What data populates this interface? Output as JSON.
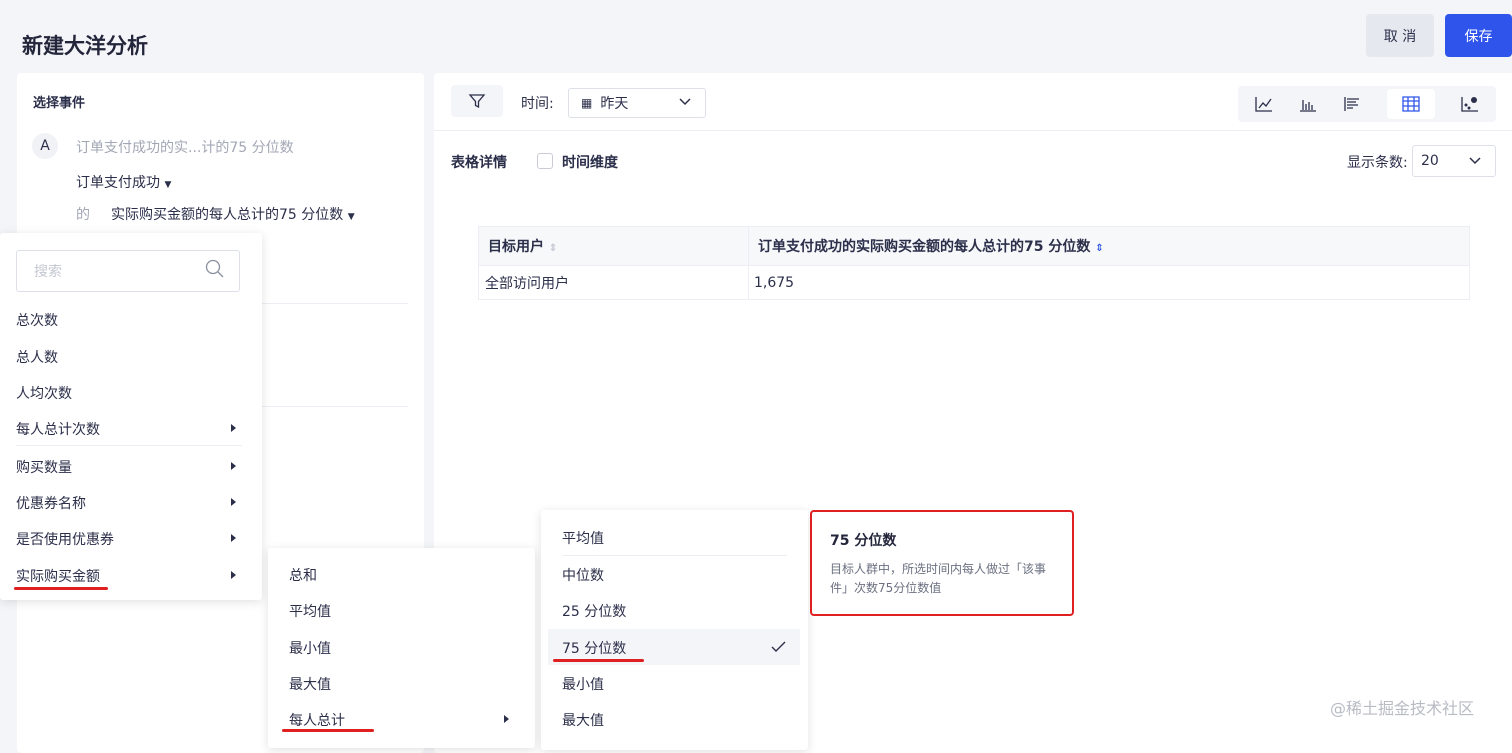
{
  "header": {
    "title": "新建大洋分析",
    "cancel": "取 消",
    "save": "保存"
  },
  "left": {
    "section_title": "选择事件",
    "event_badge": "A",
    "event_name_placeholder": "订单支付成功的实...计的75 分位数",
    "event": "订单支付成功",
    "of": "的",
    "metric": "实际购买金额的每人总计的75 分位数"
  },
  "menu1": {
    "search_placeholder": "搜索",
    "items": [
      {
        "label": "总次数"
      },
      {
        "label": "总人数"
      },
      {
        "label": "人均次数"
      },
      {
        "label": "每人总计次数"
      },
      {
        "label": "购买数量"
      },
      {
        "label": "优惠券名称"
      },
      {
        "label": "是否使用优惠券"
      },
      {
        "label": "实际购买金额"
      }
    ]
  },
  "menu2": {
    "items": [
      {
        "label": "总和"
      },
      {
        "label": "平均值"
      },
      {
        "label": "最小值"
      },
      {
        "label": "最大值"
      },
      {
        "label": "每人总计"
      }
    ]
  },
  "menu3": {
    "items": [
      {
        "label": "平均值"
      },
      {
        "label": "中位数"
      },
      {
        "label": "25 分位数"
      },
      {
        "label": "75 分位数",
        "selected": true
      },
      {
        "label": "最小值"
      },
      {
        "label": "最大值"
      }
    ]
  },
  "tooltip": {
    "title": "75 分位数",
    "desc": "目标人群中，所选时间内每人做过「该事件」次数75分位数值"
  },
  "toolbar": {
    "time_label": "时间:",
    "time_value": "昨天"
  },
  "table_section": {
    "title": "表格详情",
    "time_dim": "时间维度",
    "rows_label": "显示条数:",
    "rows_value": "20",
    "columns": [
      "目标用户",
      "订单支付成功的实际购买金额的每人总计的75 分位数"
    ],
    "rows": [
      [
        "全部访问用户",
        "1,675"
      ]
    ]
  },
  "watermark": "@稀土掘金技术社区",
  "colors": {
    "primary": "#2f54eb",
    "highlight": "#e02020"
  }
}
